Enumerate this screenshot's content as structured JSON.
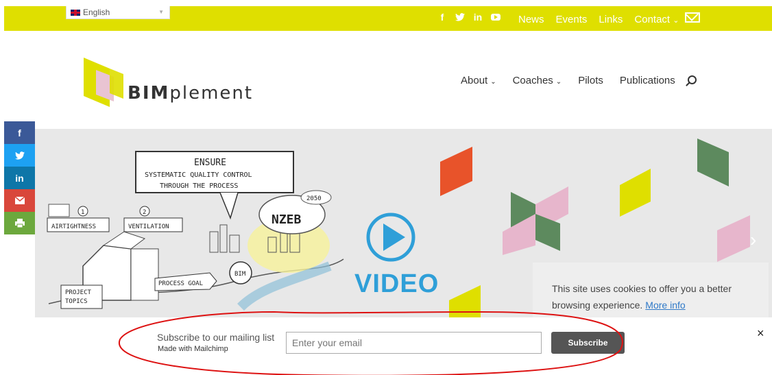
{
  "language": {
    "selected": "English"
  },
  "top_nav": {
    "social": [
      "facebook-icon",
      "twitter-icon",
      "linkedin-icon",
      "youtube-icon"
    ],
    "links": [
      "News",
      "Events",
      "Links",
      "Contact"
    ],
    "contact_chevron": "⌄"
  },
  "brand": {
    "bold": "BIM",
    "rest": "plement"
  },
  "main_nav": {
    "items": [
      {
        "label": "About",
        "chevron": "⌄"
      },
      {
        "label": "Coaches",
        "chevron": "⌄"
      },
      {
        "label": "Pilots"
      },
      {
        "label": "Publications"
      }
    ]
  },
  "share_bar": {
    "items": [
      {
        "icon": "facebook-icon",
        "glyph": "f",
        "color": "#3b5998"
      },
      {
        "icon": "twitter-icon",
        "glyph": "🐦",
        "color": "#1da1f2"
      },
      {
        "icon": "linkedin-icon",
        "glyph": "in",
        "color": "#0e76a8"
      },
      {
        "icon": "email-icon",
        "glyph": "✉",
        "color": "#d9473b"
      },
      {
        "icon": "print-icon",
        "glyph": "🖶",
        "color": "#6ca83d"
      }
    ]
  },
  "hero": {
    "ensure": "ENSURE",
    "quality": "SYSTEMATIC QUALITY CONTROL",
    "process": "THROUGH THE PROCESS",
    "airtightness": "AIRTIGHTNESS",
    "ventilation": "VENTILATION",
    "num1": "1",
    "num2": "2",
    "nzeb": "NZEB",
    "year": "2050",
    "process_goal": "PROCESS GOAL",
    "project_topics_1": "PROJECT",
    "project_topics_2": "TOPICS",
    "bim": "BIM",
    "video_label": "VIDEO",
    "next": "›"
  },
  "cookie": {
    "text": "This site uses cookies to offer you a better browsing experience.",
    "link": "More info"
  },
  "subscribe": {
    "title": "Subscribe to our mailing list",
    "made_with": "Made with",
    "made_with_brand": "Mailchimp",
    "placeholder": "Enter your email",
    "button": "Subscribe",
    "close": "×"
  },
  "colors": {
    "accent_yellow": "#dfdf00",
    "video_blue": "#2f9fd8",
    "shape_orange": "#e8532a",
    "shape_green": "#5d8a5e",
    "shape_pink": "#e7b6cc",
    "annotation_red": "#d11"
  }
}
